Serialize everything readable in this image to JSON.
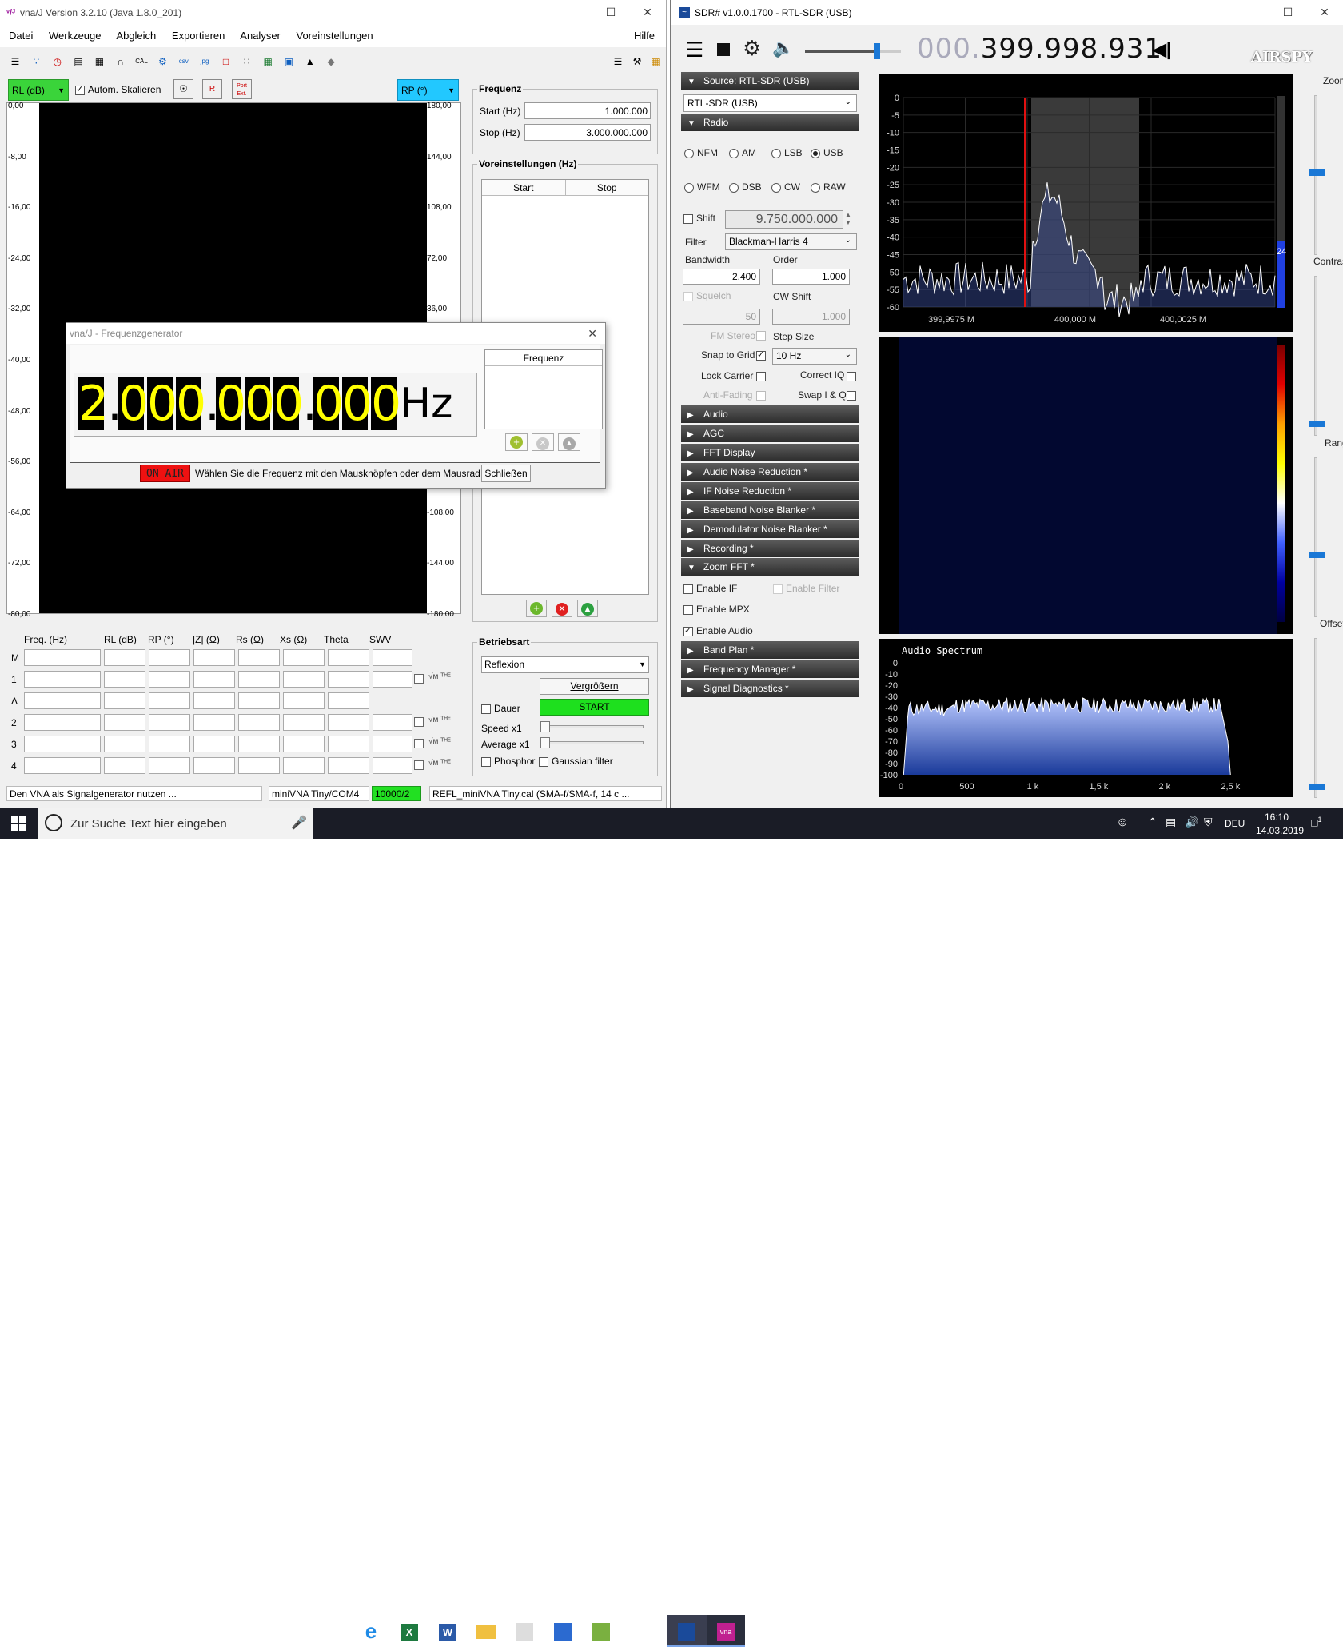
{
  "vna": {
    "title": "vna/J Version 3.2.10 (Java 1.8.0_201)",
    "menu": [
      "Datei",
      "Werkzeuge",
      "Abgleich",
      "Exportieren",
      "Analyser",
      "Voreinstellungen"
    ],
    "help": "Hilfe",
    "left_select": "RL (dB)",
    "autoscale": "Autom. Skalieren",
    "right_select": "RP (°)",
    "y_left": [
      "0,00",
      "-8,00",
      "-16,00",
      "-24,00",
      "-32,00",
      "-40,00",
      "-48,00",
      "-56,00",
      "-64,00",
      "-72,00",
      "-80,00"
    ],
    "y_right": [
      "180,00",
      "144,00",
      "108,00",
      "72,00",
      "36,00",
      "-108,00",
      "-144,00",
      "-180,00"
    ],
    "freq_group": "Frequenz",
    "start_label": "Start (Hz)",
    "start_value": "1.000.000",
    "stop_label": "Stop (Hz)",
    "stop_value": "3.000.000.000",
    "presets_group": "Voreinstellungen (Hz)",
    "presets_cols": [
      "Start",
      "Stop"
    ],
    "marker_cols": [
      "Freq. (Hz)",
      "RL (dB)",
      "RP (°)",
      "|Z| (Ω)",
      "Rs (Ω)",
      "Xs (Ω)",
      "Theta",
      "SWV"
    ],
    "marker_rows": [
      "M",
      "1",
      "Δ",
      "2",
      "3",
      "4"
    ],
    "mode_group": "Betriebsart",
    "mode_value": "Reflexion",
    "enlarge": "Vergrößern",
    "continuous": "Dauer",
    "start_btn": "START",
    "speed": "Speed x1",
    "average": "Average x1",
    "phosphor": "Phosphor",
    "gaussian": "Gaussian filter",
    "status1": "Den VNA als Signalgenerator nutzen ...",
    "status2": "miniVNA Tiny/COM4",
    "status3": "10000/2",
    "status4": "REFL_miniVNA Tiny.cal (SMA-f/SMA-f, 14 c ..."
  },
  "gen": {
    "title": "vna/J - Frequenzgenerator",
    "digits": [
      "2",
      ".",
      "0",
      "0",
      "0",
      ".",
      "0",
      "0",
      "0",
      ".",
      "0",
      "0",
      "0"
    ],
    "unit": "Hz",
    "list_header": "Frequenz",
    "on_air": "ON AIR",
    "hint": "Wählen Sie die Frequenz mit den Mausknöpfen oder dem Mausrad",
    "close": "Schließen"
  },
  "sdr": {
    "title": "SDR# v1.0.0.1700 - RTL-SDR (USB)",
    "freq_dim": "000.",
    "freq_main": "399.998.931",
    "logo": "AIRSPY",
    "source_hdr": "Source: RTL-SDR (USB)",
    "source_val": "RTL-SDR (USB)",
    "radio_hdr": "Radio",
    "modes": [
      "NFM",
      "AM",
      "LSB",
      "USB",
      "WFM",
      "DSB",
      "CW",
      "RAW"
    ],
    "shift": "Shift",
    "shift_val": "9.750.000.000",
    "filter": "Filter",
    "filter_val": "Blackman-Harris 4",
    "bandwidth": "Bandwidth",
    "order": "Order",
    "bw_val": "2.400",
    "order_val": "1.000",
    "squelch": "Squelch",
    "cwshift": "CW Shift",
    "sq_val": "50",
    "cw_val": "1.000",
    "fmstereo": "FM Stereo",
    "stepsize": "Step Size",
    "snap": "Snap to Grid",
    "snap_val": "10 Hz",
    "lock": "Lock Carrier",
    "correctiq": "Correct IQ",
    "antifading": "Anti-Fading",
    "swapiq": "Swap I & Q",
    "sections_a": [
      "Audio",
      "AGC",
      "FFT Display",
      "Audio Noise Reduction *",
      "IF Noise Reduction *",
      "Baseband Noise Blanker *",
      "Demodulator Noise Blanker *",
      "Recording *"
    ],
    "zoomfft": "Zoom FFT *",
    "enable_if": "Enable IF",
    "enable_filter": "Enable Filter",
    "enable_mpx": "Enable MPX",
    "enable_audio": "Enable Audio",
    "sections_b": [
      "Band Plan *",
      "Frequency Manager *",
      "Signal Diagnostics *"
    ],
    "spec_y": [
      "0",
      "-5",
      "-10",
      "-15",
      "-20",
      "-25",
      "-30",
      "-35",
      "-40",
      "-45",
      "-50",
      "-55",
      "-60"
    ],
    "spec_x": [
      "399,9975 M",
      "400,000 M",
      "400,0025 M"
    ],
    "level": "24",
    "side": [
      "Zoom",
      "Contrast",
      "Range",
      "Offset"
    ],
    "audio_title": "Audio Spectrum",
    "audio_y": [
      "0",
      "-10",
      "-20",
      "-30",
      "-40",
      "-50",
      "-60",
      "-70",
      "-80",
      "-90",
      "-100"
    ],
    "audio_x": [
      "0",
      "500",
      "1 k",
      "1,5 k",
      "2 k",
      "2,5 k"
    ]
  },
  "taskbar": {
    "search": "Zur Suche Text hier eingeben",
    "lang": "DEU",
    "time": "16:10",
    "date": "14.03.2019",
    "notif": "1"
  }
}
